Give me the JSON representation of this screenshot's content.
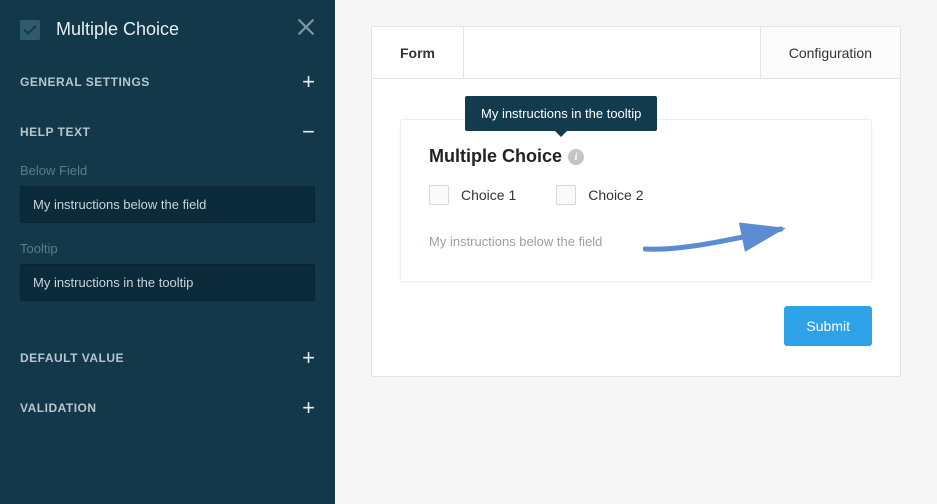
{
  "sidebar": {
    "title": "Multiple Choice",
    "sections": {
      "general": {
        "label": "GENERAL SETTINGS",
        "expanded": false
      },
      "help": {
        "label": "HELP TEXT",
        "expanded": true,
        "below_field_label": "Below Field",
        "below_field_value": "My instructions below the field",
        "tooltip_label": "Tooltip",
        "tooltip_value": "My instructions in the tooltip"
      },
      "default": {
        "label": "DEFAULT VALUE",
        "expanded": false
      },
      "validation": {
        "label": "VALIDATION",
        "expanded": false
      }
    }
  },
  "main": {
    "tabs": {
      "form": "Form",
      "configuration": "Configuration"
    },
    "field": {
      "title": "Multiple Choice",
      "tooltip_text": "My instructions in the tooltip",
      "choices": [
        "Choice 1",
        "Choice 2"
      ],
      "below_text": "My instructions below the field"
    },
    "submit_label": "Submit"
  }
}
